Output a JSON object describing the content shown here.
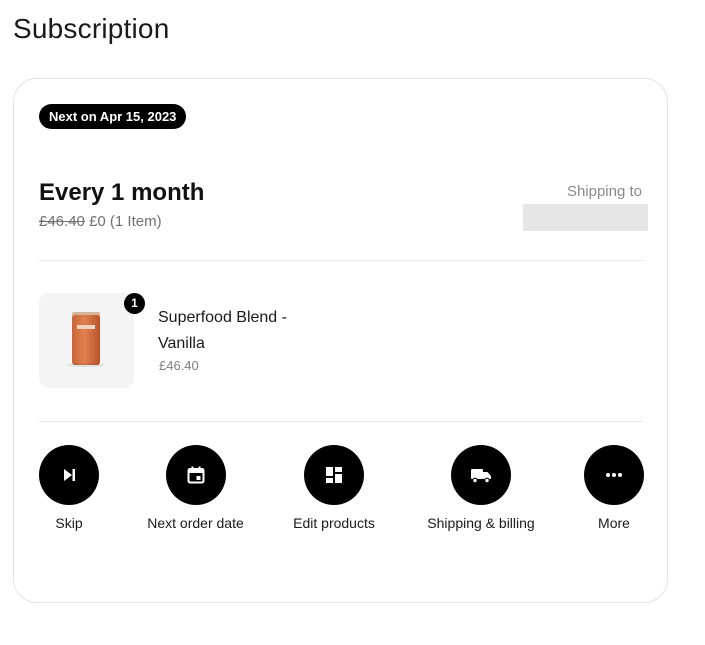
{
  "page": {
    "title": "Subscription"
  },
  "subscription": {
    "next_badge": "Next on Apr 15, 2023",
    "frequency": "Every 1 month",
    "original_price": "£46.40",
    "price": "£0",
    "item_count": "(1 Item)",
    "shipping_label": "Shipping to",
    "shipping_value": ""
  },
  "product": {
    "name": "Superfood Blend - Vanilla",
    "price": "£46.40",
    "quantity": "1"
  },
  "actions": [
    {
      "label": "Skip",
      "icon": "skip-next-icon"
    },
    {
      "label": "Next order date",
      "icon": "calendar-icon"
    },
    {
      "label": "Edit products",
      "icon": "dashboard-grid-icon"
    },
    {
      "label": "Shipping & billing",
      "icon": "truck-icon"
    },
    {
      "label": "More",
      "icon": "more-dots-icon"
    }
  ],
  "colors": {
    "accent": "#000000",
    "muted_text": "#707070",
    "border": "#e3e3e3",
    "product_can": "#e0814f"
  }
}
